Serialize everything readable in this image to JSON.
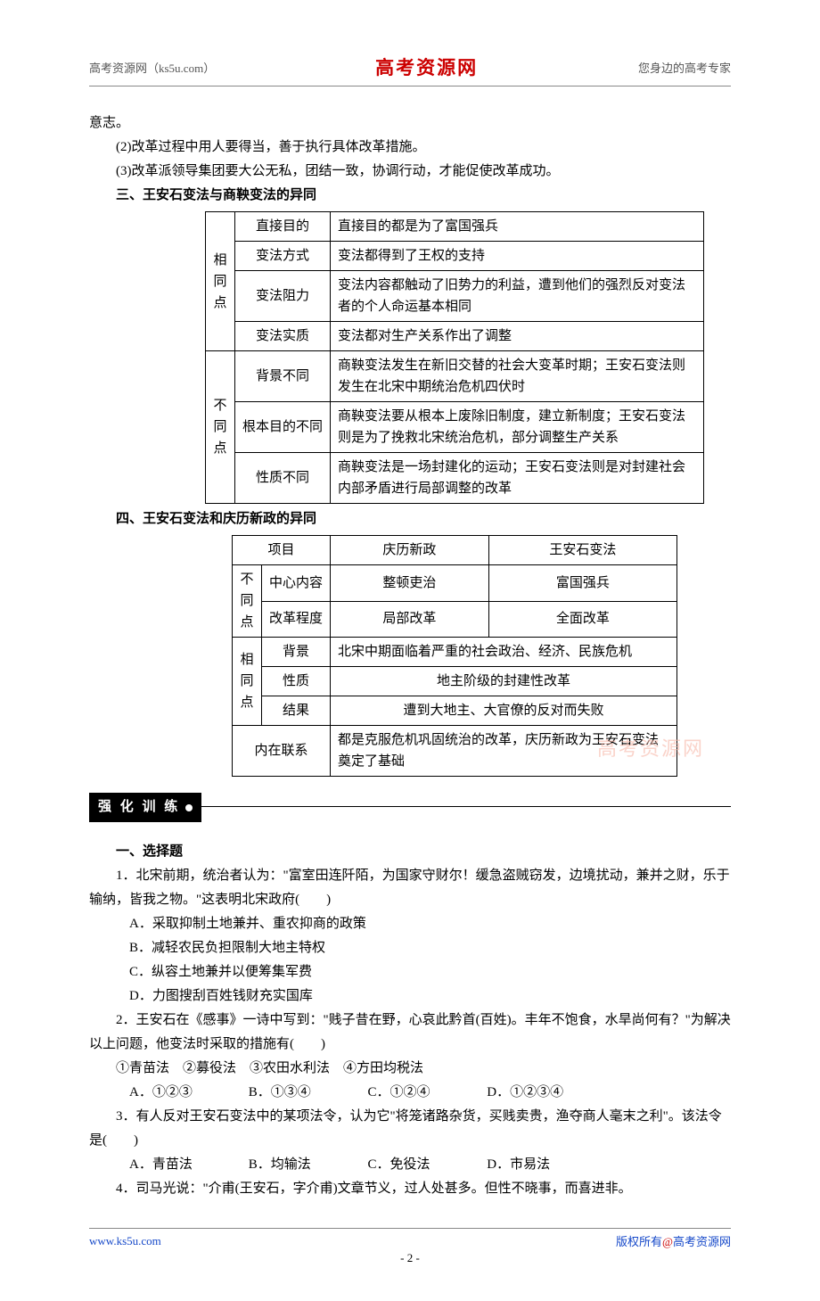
{
  "header": {
    "left": "高考资源网（ks5u.com）",
    "center": "高考资源网",
    "right": "您身边的高考专家"
  },
  "intro": {
    "line0": "意志。",
    "line1": "(2)改革过程中用人要得当，善于执行具体改革措施。",
    "line2": "(3)改革派领导集团要大公无私，团结一致，协调行动，才能促使改革成功。"
  },
  "section3": {
    "title": "三、王安石变法与商鞅变法的异同",
    "same": {
      "group": "相同点",
      "rows": [
        {
          "label": "直接目的",
          "text": "直接目的都是为了富国强兵"
        },
        {
          "label": "变法方式",
          "text": "变法都得到了王权的支持"
        },
        {
          "label": "变法阻力",
          "text": "变法内容都触动了旧势力的利益，遭到他们的强烈反对变法者的个人命运基本相同"
        },
        {
          "label": "变法实质",
          "text": "变法都对生产关系作出了调整"
        }
      ]
    },
    "diff": {
      "group": "不同点",
      "rows": [
        {
          "label": "背景不同",
          "text": "商鞅变法发生在新旧交替的社会大变革时期；王安石变法则发生在北宋中期统治危机四伏时"
        },
        {
          "label": "根本目的不同",
          "text": "商鞅变法要从根本上废除旧制度，建立新制度；王安石变法则是为了挽救北宋统治危机，部分调整生产关系"
        },
        {
          "label": "性质不同",
          "text": "商鞅变法是一场封建化的运动；王安石变法则是对封建社会内部矛盾进行局部调整的改革"
        }
      ]
    }
  },
  "section4": {
    "title": "四、王安石变法和庆历新政的异同",
    "header": {
      "c1": "项目",
      "c2": "庆历新政",
      "c3": "王安石变法"
    },
    "diff": {
      "group": "不同点",
      "rows": [
        {
          "label": "中心内容",
          "a": "整顿吏治",
          "b": "富国强兵"
        },
        {
          "label": "改革程度",
          "a": "局部改革",
          "b": "全面改革"
        }
      ]
    },
    "same": {
      "group": "相同点",
      "rows": [
        {
          "label": "背景",
          "text": "北宋中期面临着严重的社会政治、经济、民族危机"
        },
        {
          "label": "性质",
          "text": "地主阶级的封建性改革"
        },
        {
          "label": "结果",
          "text": "遭到大地主、大官僚的反对而失败"
        }
      ]
    },
    "link": {
      "label": "内在联系",
      "text": "都是克服危机巩固统治的改革，庆历新政为王安石变法奠定了基础"
    }
  },
  "training": {
    "banner": "强 化 训 练",
    "mcq_title": "一、选择题",
    "q1": {
      "stem": "1．北宋前期，统治者认为：\"富室田连阡陌，为国家守财尔！缓急盗贼窃发，边境扰动，兼并之财，乐于输纳，皆我之物。\"这表明北宋政府(　　)",
      "a": "A．采取抑制土地兼并、重农抑商的政策",
      "b": "B．减轻农民负担限制大地主特权",
      "c": "C．纵容土地兼并以便筹集军费",
      "d": "D．力图搜刮百姓钱财充实国库"
    },
    "q2": {
      "stem": "2．王安石在《感事》一诗中写到：\"贱子昔在野，心哀此黔首(百姓)。丰年不饱食，水旱尚何有？\"为解决以上问题，他变法时采取的措施有(　　)",
      "items": "①青苗法　②募役法　③农田水利法　④方田均税法",
      "a": "A．①②③",
      "b": "B．①③④",
      "c": "C．①②④",
      "d": "D．①②③④"
    },
    "q3": {
      "stem": "3．有人反对王安石变法中的某项法令，认为它\"将笼诸路杂货，买贱卖贵，渔夺商人毫末之利\"。该法令是(　　)",
      "a": "A．青苗法",
      "b": "B．均输法",
      "c": "C．免役法",
      "d": "D．市易法"
    },
    "q4": {
      "stem": "4．司马光说：\"介甫(王安石，字介甫)文章节义，过人处甚多。但性不晓事，而喜进非。"
    }
  },
  "watermark": "高考资源网",
  "footer": {
    "left": "www.ks5u.com",
    "right_prefix": "版权所有",
    "right_at": "@",
    "right_suffix": "高考资源网",
    "page": "- 2 -"
  }
}
